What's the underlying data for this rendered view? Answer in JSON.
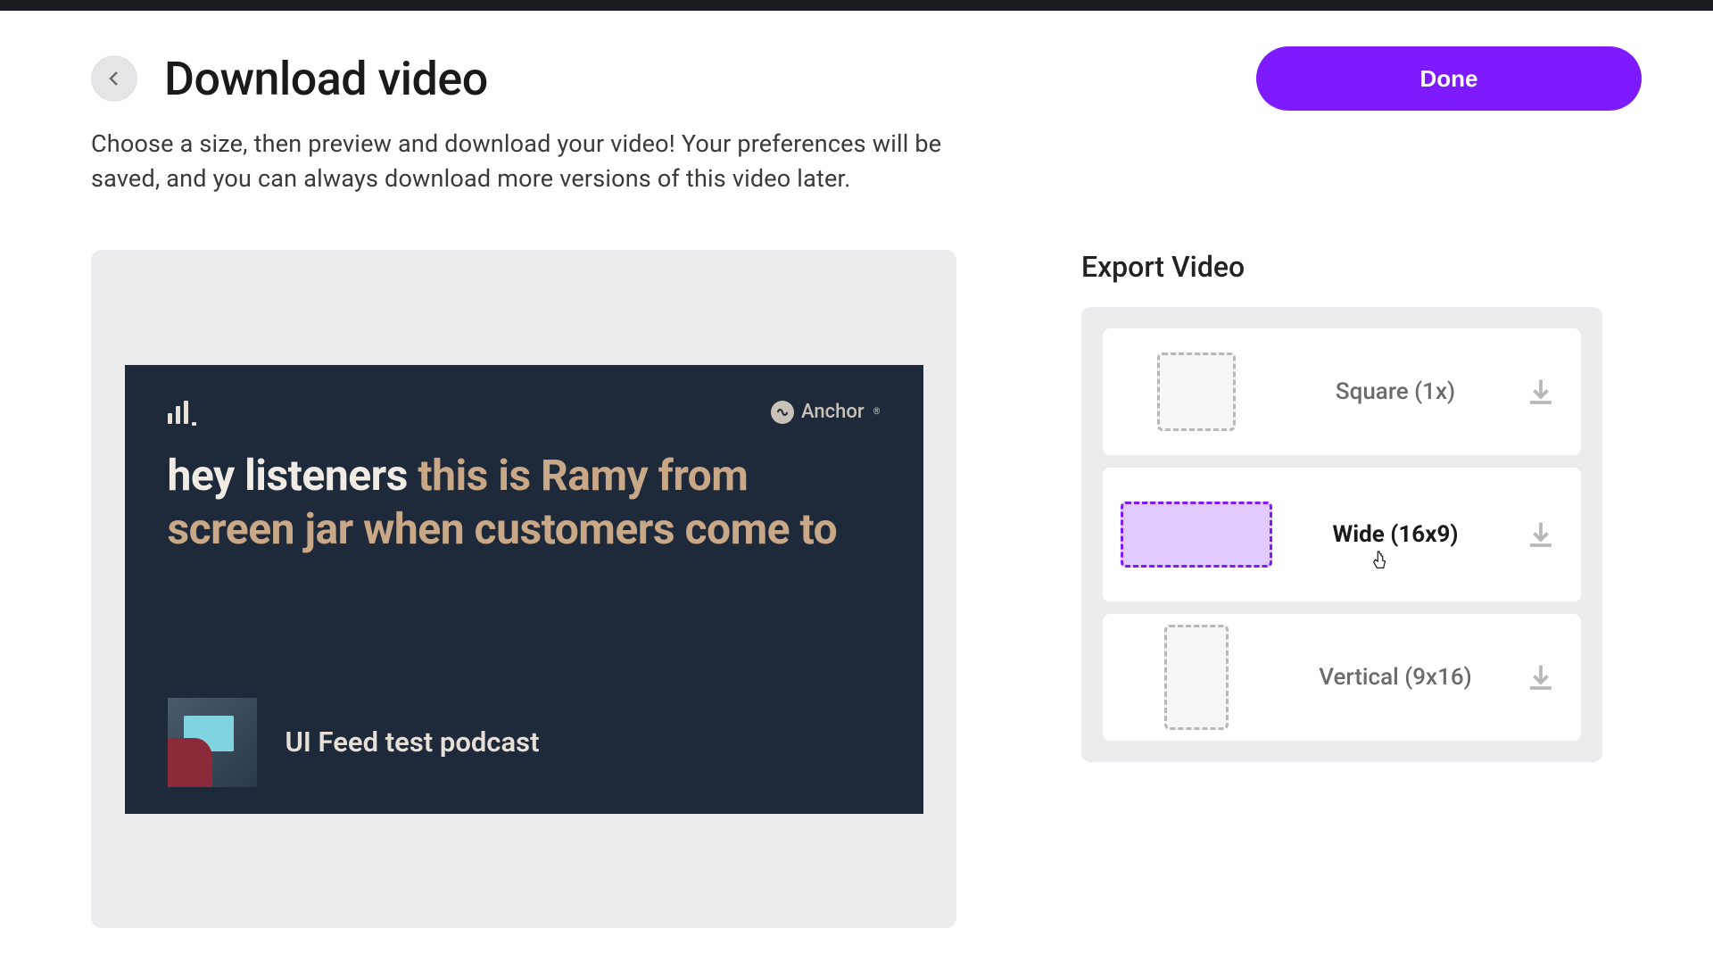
{
  "header": {
    "title": "Download video",
    "done_label": "Done"
  },
  "description": "Choose a size, then preview and download your video! Your preferences will be saved, and you can always download more versions of this video later.",
  "preview": {
    "brand_name": "Anchor",
    "transcript_spoken": "hey listeners",
    "transcript_upcoming": " this is Ramy from screen jar when customers come to",
    "podcast_name": "UI Feed test podcast"
  },
  "export": {
    "heading": "Export Video",
    "options": [
      {
        "id": "square",
        "label": "Square (1x)"
      },
      {
        "id": "wide",
        "label": "Wide (16x9)"
      },
      {
        "id": "vertical",
        "label": "Vertical (9x16)"
      }
    ]
  }
}
